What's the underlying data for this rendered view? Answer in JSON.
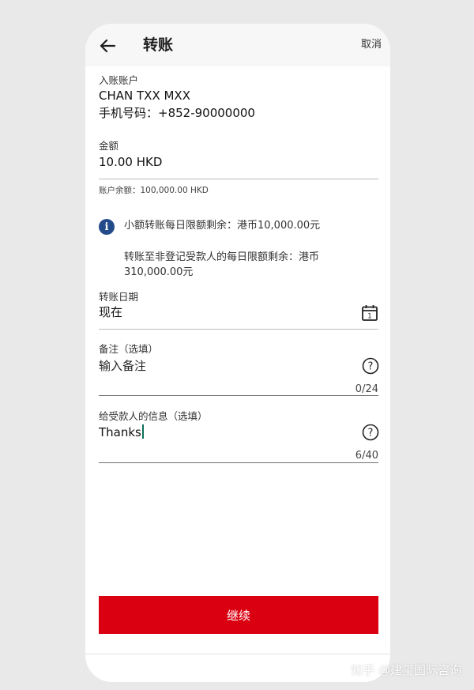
{
  "header": {
    "title": "转账",
    "cancel_label": "取消"
  },
  "payee": {
    "label": "入账账户",
    "name": "CHAN TXX MXX",
    "phone": "手机号码：+852-90000000"
  },
  "amount": {
    "label": "金额",
    "value": "10.00 HKD",
    "balance": "账户余额：100,000.00 HKD"
  },
  "limits": {
    "small_transfer": "小额转账每日限额剩余：港币10,000.00元",
    "non_registered_line1": "转账至非登记受款人的每日限额剩余：港币",
    "non_registered_line2": "310,000.00元"
  },
  "date": {
    "label": "转账日期",
    "value": "现在",
    "icon": "calendar-icon"
  },
  "remarks": {
    "label": "备注（选填）",
    "placeholder": "输入备注",
    "counter": "0/24",
    "icon": "help-icon"
  },
  "message": {
    "label": "给受款人的信息（选填）",
    "value": "Thanks",
    "counter": "6/40",
    "icon": "help-icon"
  },
  "actions": {
    "continue_label": "继续"
  },
  "watermark": "知乎 @建玺国际咨询",
  "colors": {
    "primary_red": "#db0011",
    "info_blue": "#234b8a",
    "background": "#e9e9e9"
  }
}
